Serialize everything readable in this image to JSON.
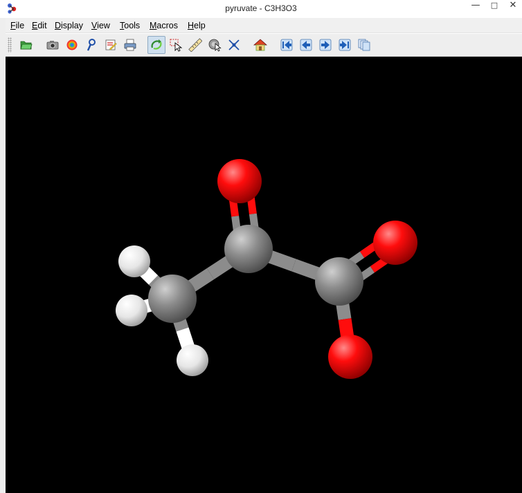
{
  "window": {
    "title": "pyruvate - C3H3O3",
    "controls": {
      "minimize": "—",
      "maximize": "□",
      "close": "✕"
    }
  },
  "menubar": [
    {
      "mnemonic": "F",
      "rest": "ile"
    },
    {
      "mnemonic": "E",
      "rest": "dit"
    },
    {
      "mnemonic": "D",
      "rest": "isplay"
    },
    {
      "mnemonic": "V",
      "rest": "iew"
    },
    {
      "mnemonic": "T",
      "rest": "ools"
    },
    {
      "mnemonic": "M",
      "rest": "acros"
    },
    {
      "mnemonic": "H",
      "rest": "elp"
    }
  ],
  "toolbar": {
    "buttons": [
      {
        "icon": "open-folder-icon",
        "pressed": false
      },
      {
        "icon": "camera-icon",
        "pressed": false
      },
      {
        "icon": "povray-render-icon",
        "pressed": false
      },
      {
        "icon": "pdb-lookup-icon",
        "pressed": false
      },
      {
        "icon": "script-editor-icon",
        "pressed": false
      },
      {
        "icon": "print-icon",
        "pressed": false
      },
      {
        "icon": "rotate-icon",
        "pressed": true
      },
      {
        "icon": "pick-select-icon",
        "pressed": false
      },
      {
        "icon": "measure-ruler-icon",
        "pressed": false
      },
      {
        "icon": "spin-cursor-icon",
        "pressed": false
      },
      {
        "icon": "atom-pick-icon",
        "pressed": false
      },
      {
        "icon": "home-icon",
        "pressed": false
      },
      {
        "icon": "first-frame-icon",
        "pressed": false
      },
      {
        "icon": "previous-frame-icon",
        "pressed": false
      },
      {
        "icon": "next-frame-icon",
        "pressed": false
      },
      {
        "icon": "last-frame-icon",
        "pressed": false
      },
      {
        "icon": "all-frames-icon",
        "pressed": false
      }
    ]
  },
  "molecule": {
    "name": "pyruvate",
    "formula": "C3H3O3",
    "background": "#000000",
    "colors": {
      "carbon": "#8c8c8c",
      "oxygen": "#ff0d0d",
      "hydrogen": "#ffffff"
    },
    "atoms": [
      {
        "id": "C1",
        "element": "C"
      },
      {
        "id": "C2",
        "element": "C"
      },
      {
        "id": "C3",
        "element": "C"
      },
      {
        "id": "O1",
        "element": "O"
      },
      {
        "id": "O2",
        "element": "O"
      },
      {
        "id": "O3",
        "element": "O"
      },
      {
        "id": "H1",
        "element": "H"
      },
      {
        "id": "H2",
        "element": "H"
      },
      {
        "id": "H3",
        "element": "H"
      }
    ],
    "bonds": [
      {
        "a": "C1",
        "b": "C2",
        "order": 1
      },
      {
        "a": "C2",
        "b": "C3",
        "order": 1
      },
      {
        "a": "C2",
        "b": "O1",
        "order": 2
      },
      {
        "a": "C3",
        "b": "O2",
        "order": 2
      },
      {
        "a": "C3",
        "b": "O3",
        "order": 1
      },
      {
        "a": "C1",
        "b": "H1",
        "order": 1
      },
      {
        "a": "C1",
        "b": "H2",
        "order": 1
      },
      {
        "a": "C1",
        "b": "H3",
        "order": 1
      }
    ]
  }
}
